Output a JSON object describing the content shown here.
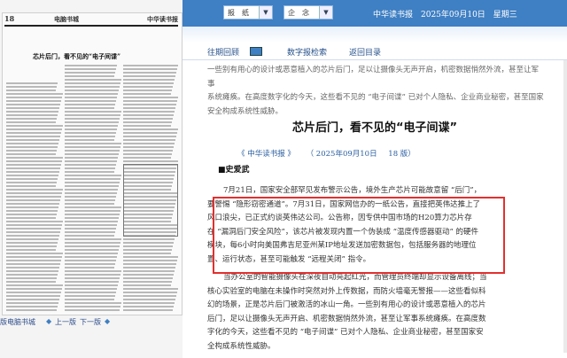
{
  "left_panel": {
    "page_number": "18",
    "section": "电脑书城",
    "brand": "中华读书报",
    "headline": "芯片后门，看不见的“电子间谍”",
    "nav_section": "版电脑书城",
    "prev_page": "上一版",
    "next_page": "下一版"
  },
  "top": {
    "select1": "报　纸",
    "select2": "企　念",
    "date_line": "中华读书报　2025年09月10日　星期三"
  },
  "nav": {
    "back_list": "往期回顾",
    "digital": "数字报检索",
    "back_dir": "返回目录"
  },
  "article": {
    "intro": [
      "一些别有用心的设计或恶意植入的芯片后门，足以让摄像头无声开启，机密数据悄然外流，甚至让军事",
      "系统瘫痪。在高度数字化的今天，这些看不见的 “电子间谍” 已对个人隐私、企业商业秘密，甚至国家",
      "安全构成系统性威胁。"
    ],
    "title": "芯片后门，看不见的“电子间谍”",
    "meta": [
      "《 中华读书报 》",
      "（ 2025年09月10日",
      "18 版）"
    ],
    "author": "■史爱武",
    "body1": [
      "7月21日，国家安全部罕见发布警示公告，境外生产芯片可能故意留 “后门”，",
      "要警惕 “隐形窃密通道”。7月31日，国家网信办的一纸公告，直接把英伟达推上了",
      "风口浪尖，已正式约谈英伟达公司。公告称，因专供中国市场的H20算力芯片存",
      "在 “漏洞后门安全风险”，该芯片被发现内置一个伪装成 “温度传感器驱动” 的硬件",
      "模块，每6小时向美国弗吉尼亚州某IP地址发送加密数据包，包括服务器的地理位",
      "置、运行状态，甚至可能触发 “远程关闭” 指令。"
    ],
    "body2": [
      "当办公室的智能摄像头在深夜自动亮起红光，而管理员终端却显示设备离线；当",
      "核心实验室的电脑在未操作时突然对外上传数据，而防火墙毫无警报——这些看似科",
      "幻的场景，正是芯片后门被激活的冰山一角。一些别有用心的设计或恶意植入的芯片",
      "后门，足以让摄像头无声开启、机密数据悄然外流，甚至让军事系统瘫痪。在高度数",
      "字化的今天，这些看不见的 “电子间谍” 已对个人隐私、企业商业秘密，甚至国家安",
      "全构成系统性威胁。"
    ]
  }
}
